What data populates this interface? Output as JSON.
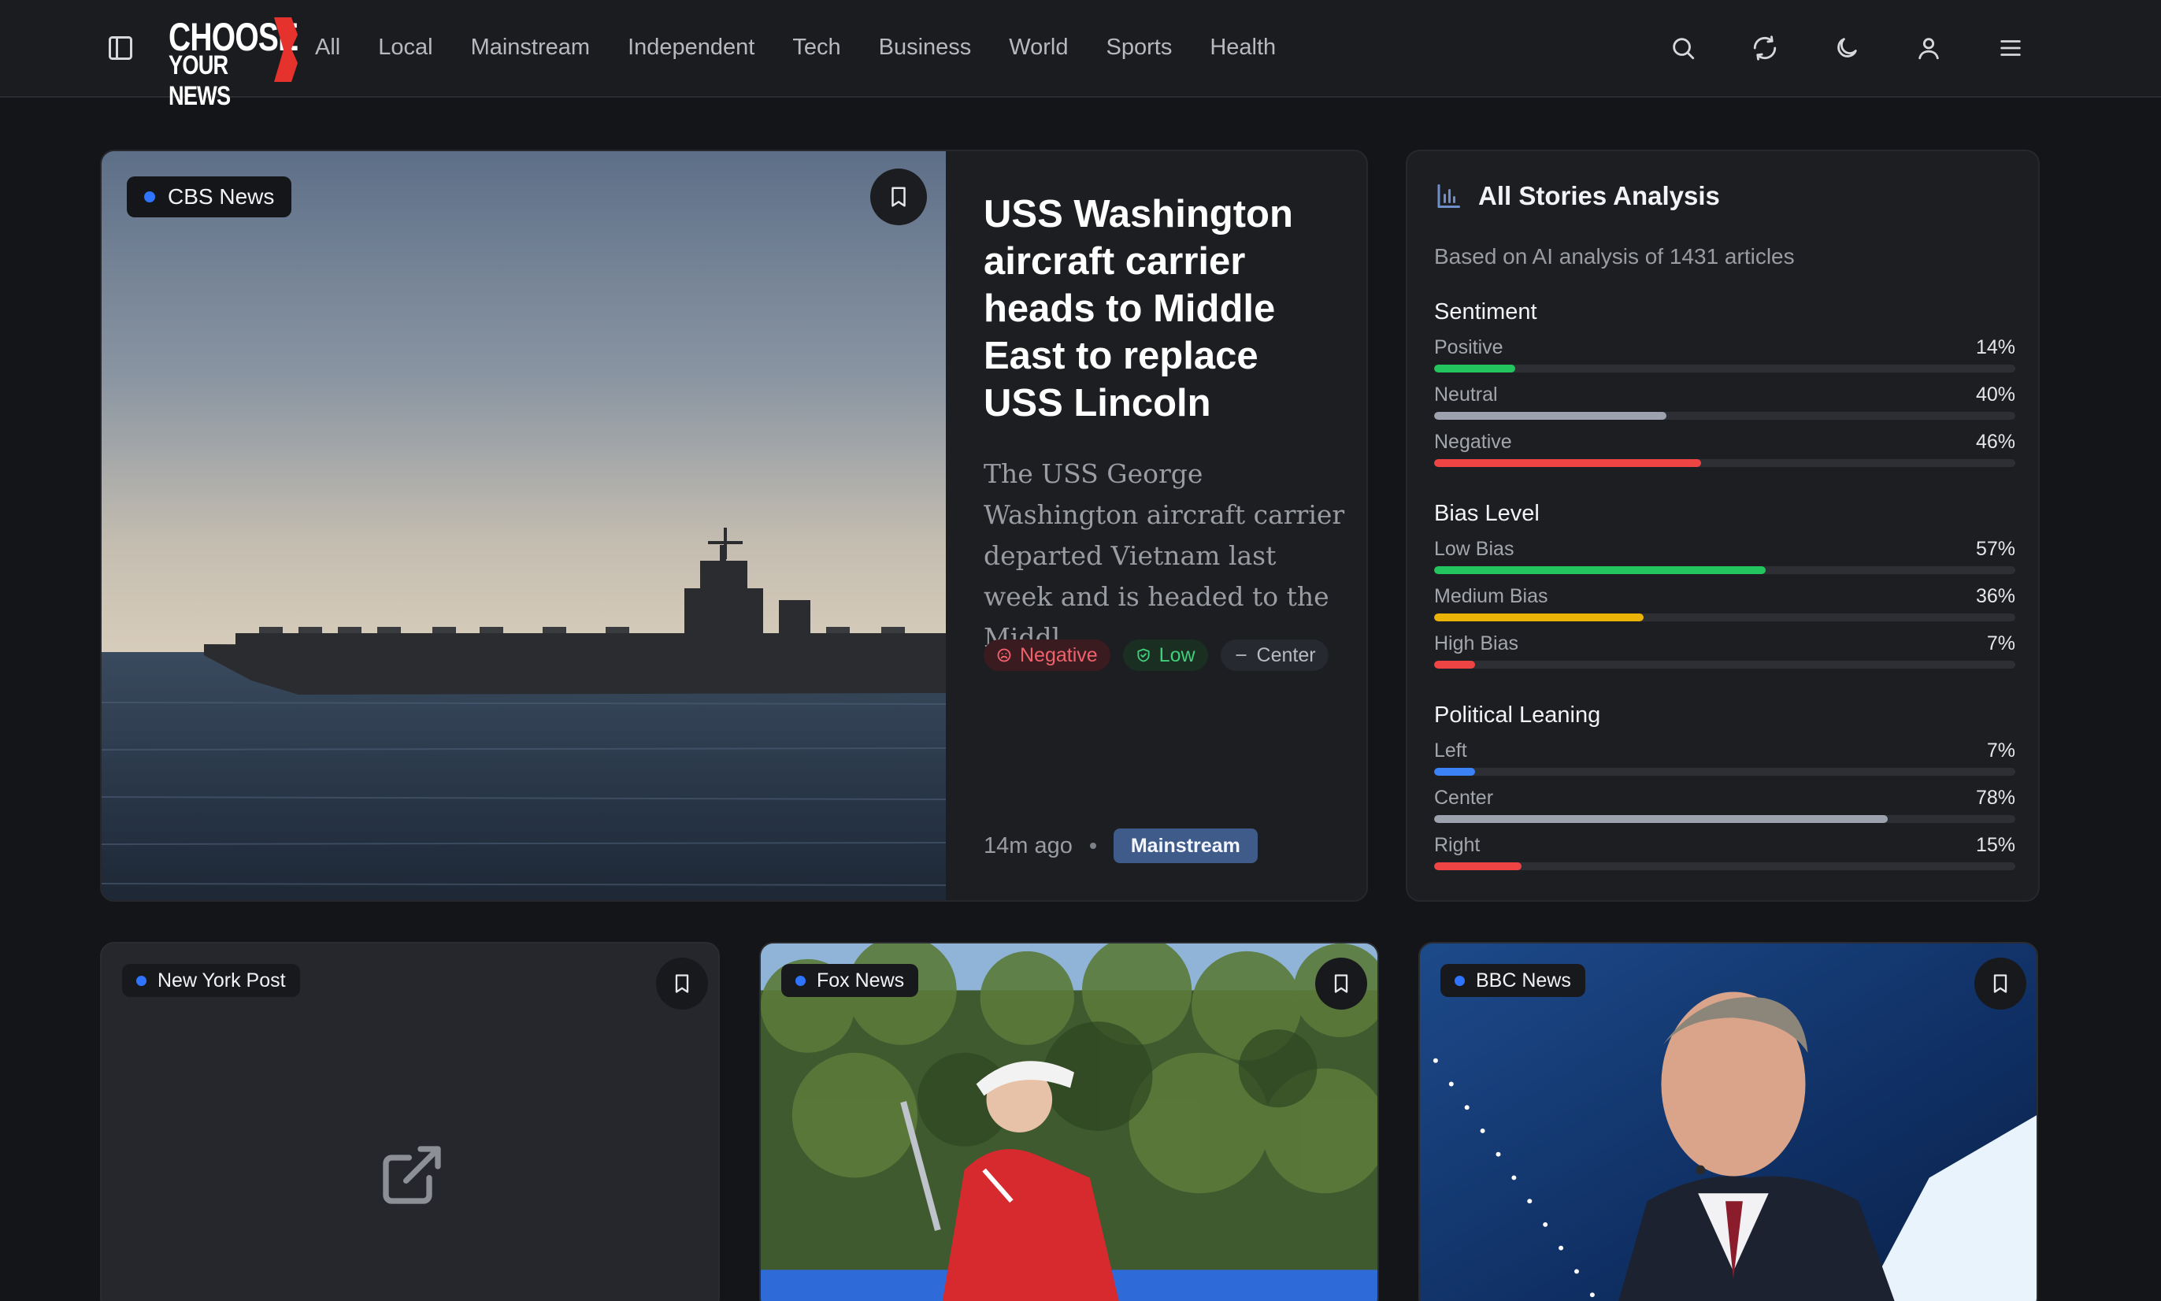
{
  "nav": {
    "links": [
      "All",
      "Local",
      "Mainstream",
      "Independent",
      "Tech",
      "Business",
      "World",
      "Sports",
      "Health"
    ],
    "logo_line1": "CHOOSE",
    "logo_line2": "YOUR NEWS",
    "icons": [
      "sidebar-toggle-icon",
      "search-icon",
      "refresh-icon",
      "moon-icon",
      "user-icon",
      "menu-icon"
    ]
  },
  "hero": {
    "source": "CBS News",
    "title": "USS Washington aircraft carrier heads to Middle East to replace USS Lincoln",
    "description": "The USS George Washington aircraft carrier departed Vietnam last week and is headed to the Middl...",
    "tags": {
      "sentiment": "Negative",
      "bias": "Low",
      "leaning": "Center"
    },
    "time": "14m ago",
    "category": "Mainstream"
  },
  "analysis": {
    "title": "All Stories Analysis",
    "subtitle": "Based on AI analysis of 1431 articles",
    "sections": [
      {
        "title": "Sentiment",
        "rows": [
          {
            "label": "Positive",
            "pct": "14%",
            "value": 14,
            "color": "#22c55e"
          },
          {
            "label": "Neutral",
            "pct": "40%",
            "value": 40,
            "color": "#9ca3af"
          },
          {
            "label": "Negative",
            "pct": "46%",
            "value": 46,
            "color": "#ef4444"
          }
        ]
      },
      {
        "title": "Bias Level",
        "rows": [
          {
            "label": "Low Bias",
            "pct": "57%",
            "value": 57,
            "color": "#22c55e"
          },
          {
            "label": "Medium Bias",
            "pct": "36%",
            "value": 36,
            "color": "#eab308"
          },
          {
            "label": "High Bias",
            "pct": "7%",
            "value": 7,
            "color": "#ef4444"
          }
        ]
      },
      {
        "title": "Political Leaning",
        "rows": [
          {
            "label": "Left",
            "pct": "7%",
            "value": 7,
            "color": "#3b82f6"
          },
          {
            "label": "Center",
            "pct": "78%",
            "value": 78,
            "color": "#9ca3af"
          },
          {
            "label": "Right",
            "pct": "15%",
            "value": 15,
            "color": "#ef4444"
          }
        ]
      }
    ]
  },
  "cards": [
    {
      "source": "New York Post"
    },
    {
      "source": "Fox News"
    },
    {
      "source": "BBC News"
    }
  ],
  "colors": {
    "background": "#141519",
    "card": "#1d1e22",
    "source_dot": "#2f74ff",
    "category_badge": "#3f5b89",
    "logo_red": "#e5322d"
  }
}
